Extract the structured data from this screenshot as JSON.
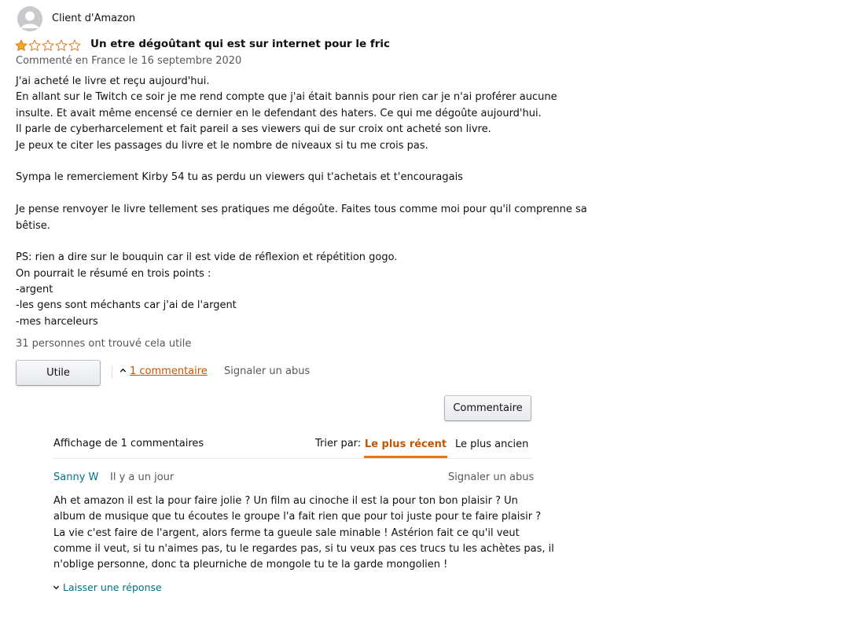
{
  "review": {
    "author": "Client d'Amazon",
    "rating": 1,
    "max_rating": 5,
    "title": "Un etre dégoûtant qui est sur internet pour le fric",
    "date_line": "Commenté en France le 16 septembre 2020",
    "body_lines": [
      "J'ai acheté le livre et reçu aujourd'hui.",
      "En allant sur le Twitch ce soir je me rend compte que j'ai était bannis pour rien car je n'ai proférer aucune",
      "insulte. Et avait même encensé ce dernier en le defendant des haters. Ce qui me dégoûte aujourd'hui.",
      "Il parle de cyberharcelement et fait pareil a ses viewers qui de sur croix ont acheté son livre.",
      "Je peux te citer les passages du livre et le nombre de niveaux si tu me crois pas.",
      "",
      "Sympa le remerciement Kirby 54 tu as perdu un viewers qui t'achetais et t'encouragais",
      "",
      "Je pense renvoyer le livre tellement ses pratiques me dégoûte. Faites tous comme moi pour qu'il comprenne sa",
      "bêtise.",
      "",
      "PS: rien a dire sur le bouquin car il est vide de réflexion et répétition gogo.",
      "On pourrait le résumé en trois points :",
      "-argent",
      "-les gens sont méchants car j'ai de l'argent",
      "-mes harceleurs"
    ],
    "helpful_count_text": "31 personnes ont trouvé cela utile"
  },
  "actions": {
    "helpful_button": "Utile",
    "comments_link": "1 commentaire",
    "report_abuse": "Signaler un abus",
    "comment_button": "Commentaire"
  },
  "comments": {
    "header": "Affichage de 1 commentaires",
    "sort_label": "Trier par:",
    "sort_options": [
      "Le plus récent",
      "Le plus ancien"
    ],
    "active_sort": "Le plus récent",
    "items": [
      {
        "author": "Sanny W",
        "time": "Il y a un jour",
        "report": "Signaler un abus",
        "body_lines": [
          "Ah et amazon il est la pour faire jolie ? Un film au cinoche il est la pour ton bon plaisir ? Un",
          "album de musique que tu écoutes le groupe l'a fait rien que pour toi juste pour te faire plaisir ?",
          "La vie c'est faire de l'argent, alors ferme ta gueule sale minable ! Astérion fait ce qu'il veut",
          "comme il veut, si tu n'aimes pas, tu le regardes pas, si tu veux pas ces trucs tu les achètes pas, il",
          "n'oblige personne, donc ta pleurniche de mongole tu te la garde mongolien !"
        ],
        "reply_link": "Laisser une réponse"
      }
    ]
  },
  "colors": {
    "star_fill": "#f0a81f",
    "star_outline": "#de7921",
    "link_orange": "#c45500",
    "link_teal": "#007185",
    "muted_text": "#565959"
  },
  "icons": {
    "avatar": "default-user-avatar-icon",
    "star": "star-icon",
    "chevron_up": "chevron-up-icon",
    "chevron_down": "chevron-down-icon"
  }
}
